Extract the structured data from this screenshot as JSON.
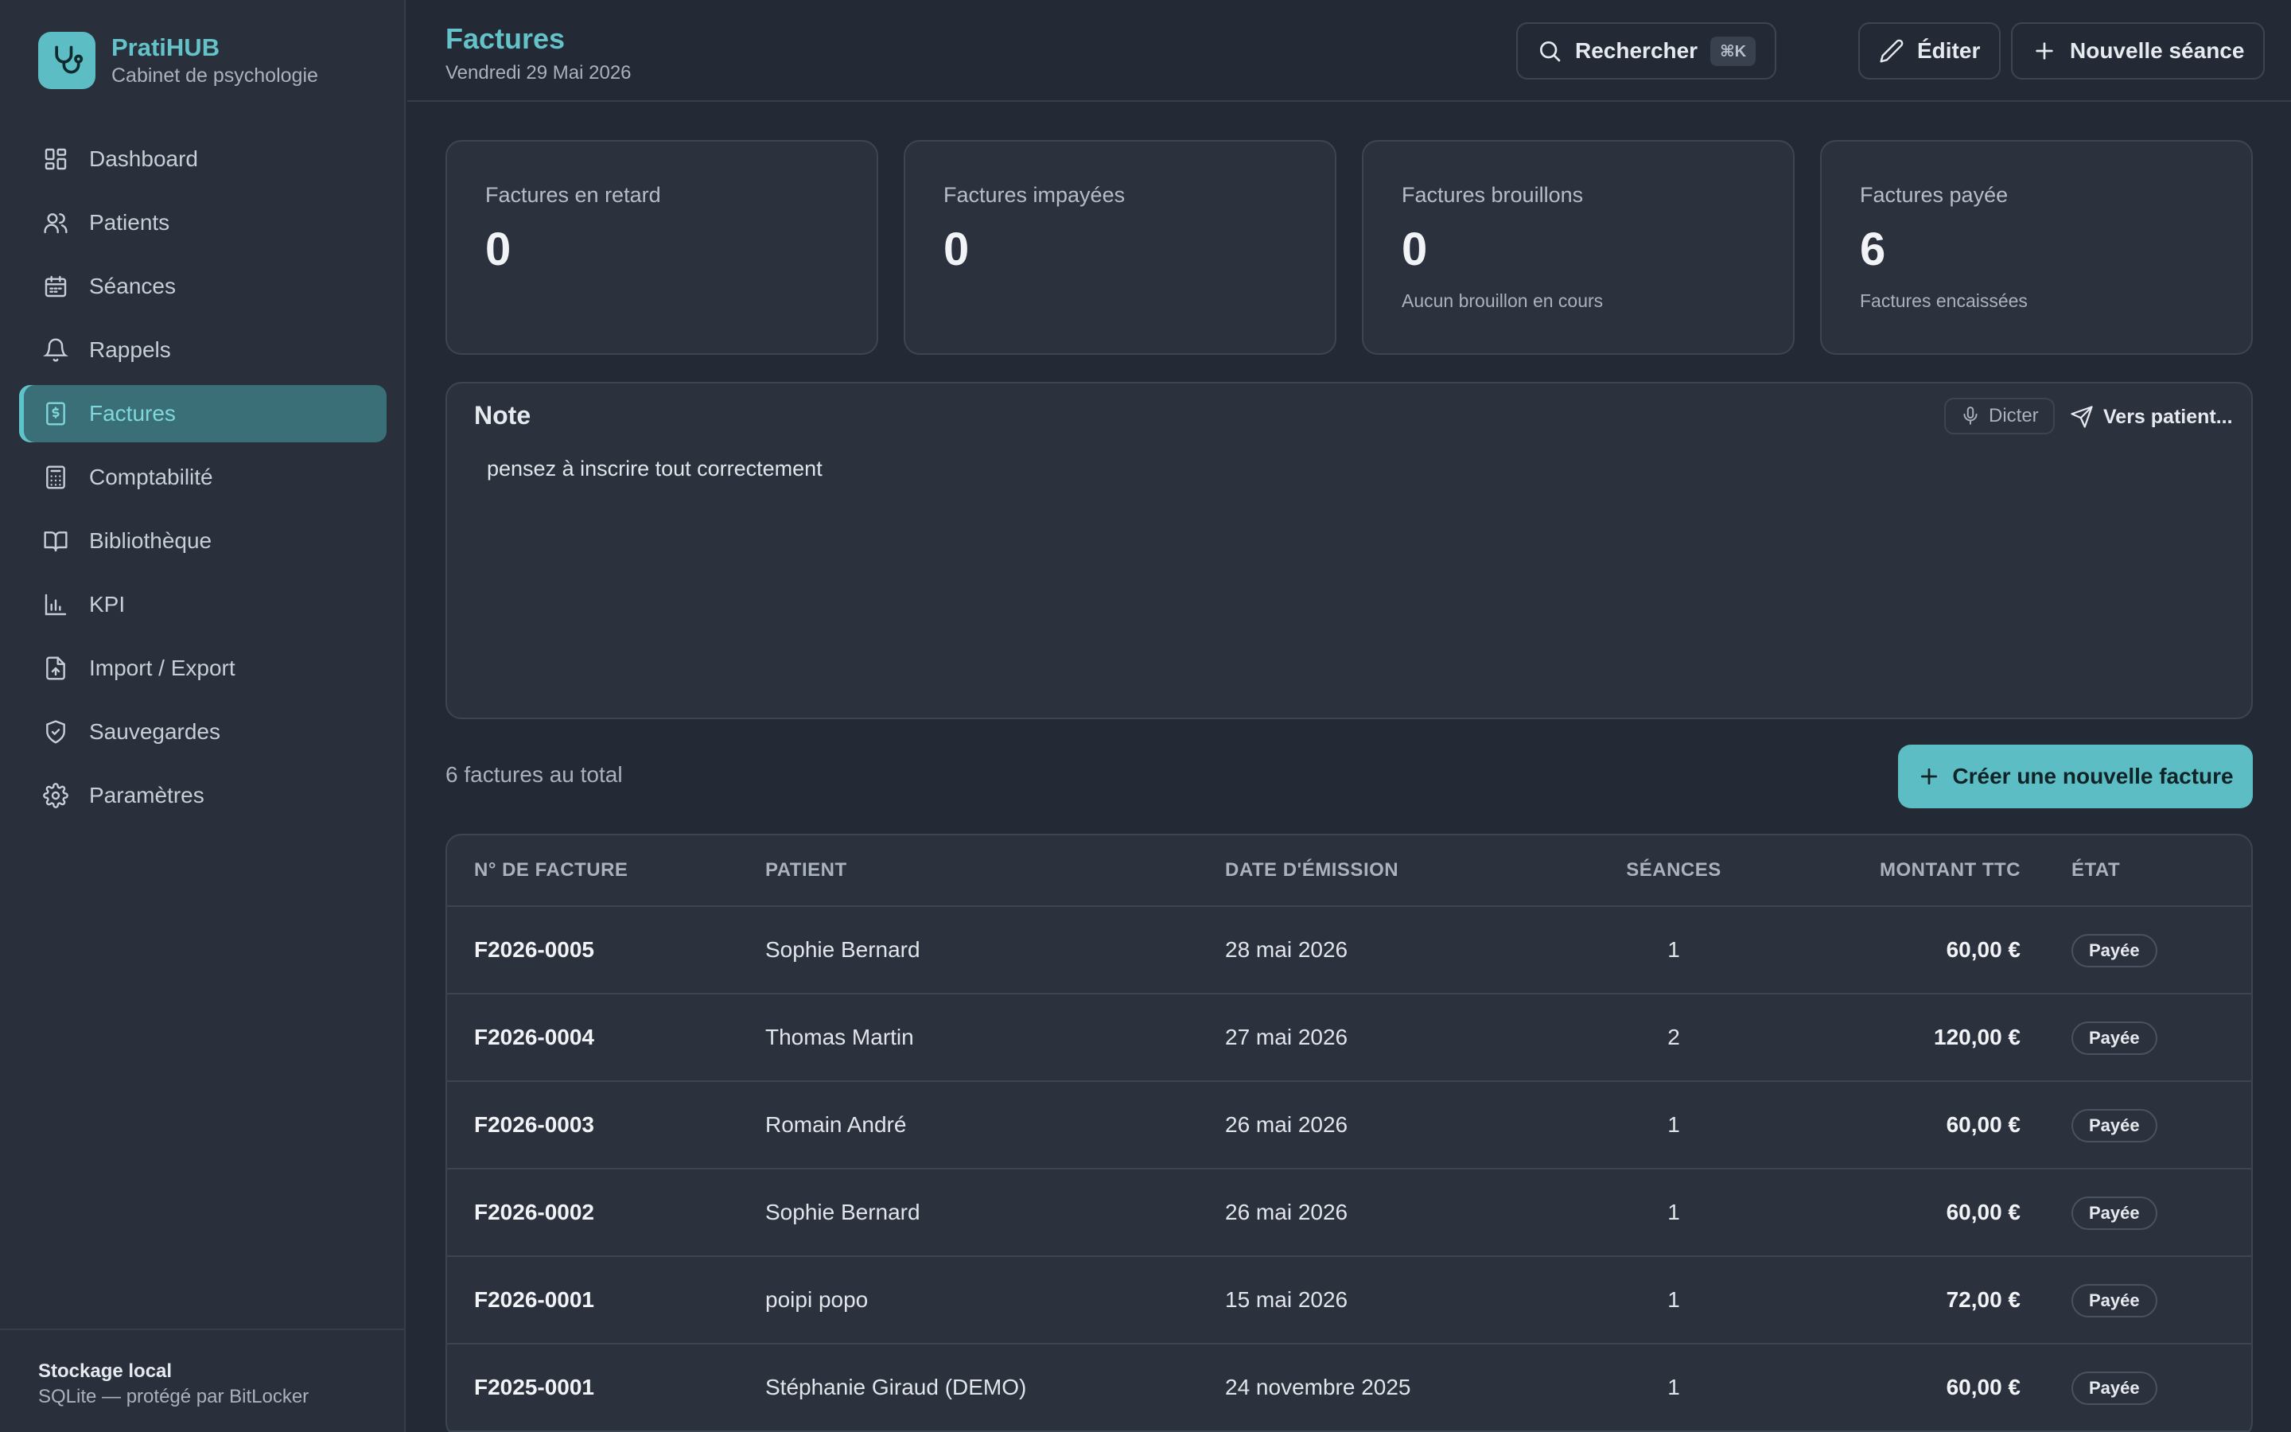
{
  "brand": {
    "name": "PratiHUB",
    "subtitle": "Cabinet de psychologie"
  },
  "sidebar": {
    "items": [
      {
        "label": "Dashboard",
        "icon": "grid-icon",
        "active": false
      },
      {
        "label": "Patients",
        "icon": "users-icon",
        "active": false
      },
      {
        "label": "Séances",
        "icon": "calendar-icon",
        "active": false
      },
      {
        "label": "Rappels",
        "icon": "bell-icon",
        "active": false
      },
      {
        "label": "Factures",
        "icon": "invoice-icon",
        "active": true
      },
      {
        "label": "Comptabilité",
        "icon": "calculator-icon",
        "active": false
      },
      {
        "label": "Bibliothèque",
        "icon": "book-icon",
        "active": false
      },
      {
        "label": "KPI",
        "icon": "bar-chart-icon",
        "active": false
      },
      {
        "label": "Import / Export",
        "icon": "file-upload-icon",
        "active": false
      },
      {
        "label": "Sauvegardes",
        "icon": "shield-icon",
        "active": false
      },
      {
        "label": "Paramètres",
        "icon": "gear-icon",
        "active": false
      }
    ],
    "storage": {
      "title": "Stockage local",
      "subtitle": "SQLite — protégé par BitLocker"
    }
  },
  "header": {
    "title": "Factures",
    "date": "Vendredi 29 Mai 2026",
    "search_label": "Rechercher",
    "search_shortcut": "⌘K",
    "edit_label": "Éditer",
    "new_session_label": "Nouvelle séance"
  },
  "stats": [
    {
      "label": "Factures en retard",
      "value": "0",
      "sub": ""
    },
    {
      "label": "Factures impayées",
      "value": "0",
      "sub": ""
    },
    {
      "label": "Factures brouillons",
      "value": "0",
      "sub": "Aucun brouillon en cours"
    },
    {
      "label": "Factures payée",
      "value": "6",
      "sub": "Factures encaissées"
    }
  ],
  "note": {
    "title": "Note",
    "dictate_label": "Dicter",
    "send_label": "Vers patient...",
    "text": "pensez à inscrire tout correctement"
  },
  "invoices": {
    "total_label": "6 factures au total",
    "create_label": "Créer une nouvelle facture",
    "columns": [
      "N° DE FACTURE",
      "PATIENT",
      "DATE D'ÉMISSION",
      "SÉANCES",
      "MONTANT TTC",
      "ÉTAT"
    ],
    "rows": [
      {
        "number": "F2026-0005",
        "patient": "Sophie Bernard",
        "date": "28 mai 2026",
        "sessions": "1",
        "amount": "60,00 €",
        "status": "Payée"
      },
      {
        "number": "F2026-0004",
        "patient": "Thomas Martin",
        "date": "27 mai 2026",
        "sessions": "2",
        "amount": "120,00 €",
        "status": "Payée"
      },
      {
        "number": "F2026-0003",
        "patient": "Romain André",
        "date": "26 mai 2026",
        "sessions": "1",
        "amount": "60,00 €",
        "status": "Payée"
      },
      {
        "number": "F2026-0002",
        "patient": "Sophie Bernard",
        "date": "26 mai 2026",
        "sessions": "1",
        "amount": "60,00 €",
        "status": "Payée"
      },
      {
        "number": "F2026-0001",
        "patient": "poipi popo",
        "date": "15 mai 2026",
        "sessions": "1",
        "amount": "72,00 €",
        "status": "Payée"
      },
      {
        "number": "F2025-0001",
        "patient": "Stéphanie Giraud (DEMO)",
        "date": "24 novembre 2025",
        "sessions": "1",
        "amount": "60,00 €",
        "status": "Payée"
      }
    ]
  },
  "colors": {
    "accent": "#5cbdc4",
    "sidebar_bg": "#29303c",
    "page_bg": "#232935",
    "card_bg": "#2b313d"
  }
}
